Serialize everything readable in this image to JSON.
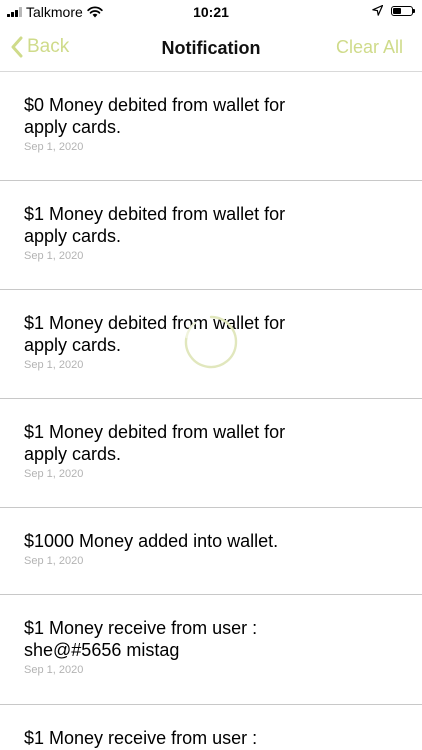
{
  "status_bar": {
    "carrier": "Talkmore",
    "time": "10:21",
    "battery_level": 0.45
  },
  "nav": {
    "back_label": "Back",
    "title": "Notification",
    "clear_all_label": "Clear All",
    "accent_color": "#cfdb8a"
  },
  "notifications": [
    {
      "title": "$0 Money debited from wallet for\napply cards.",
      "date": "Sep 1, 2020"
    },
    {
      "title": "$1 Money debited from wallet for\napply cards.",
      "date": "Sep 1, 2020"
    },
    {
      "title": "$1 Money debited from wallet for\napply cards.",
      "date": "Sep 1, 2020"
    },
    {
      "title": "$1 Money debited from wallet for\napply cards.",
      "date": "Sep 1, 2020"
    },
    {
      "title": "$1000 Money added into wallet.",
      "date": "Sep 1, 2020"
    },
    {
      "title": "$1 Money receive from user :\nshe@#5656 mistag",
      "date": "Sep 1, 2020"
    },
    {
      "title": "$1 Money receive from user :",
      "date": ""
    }
  ]
}
